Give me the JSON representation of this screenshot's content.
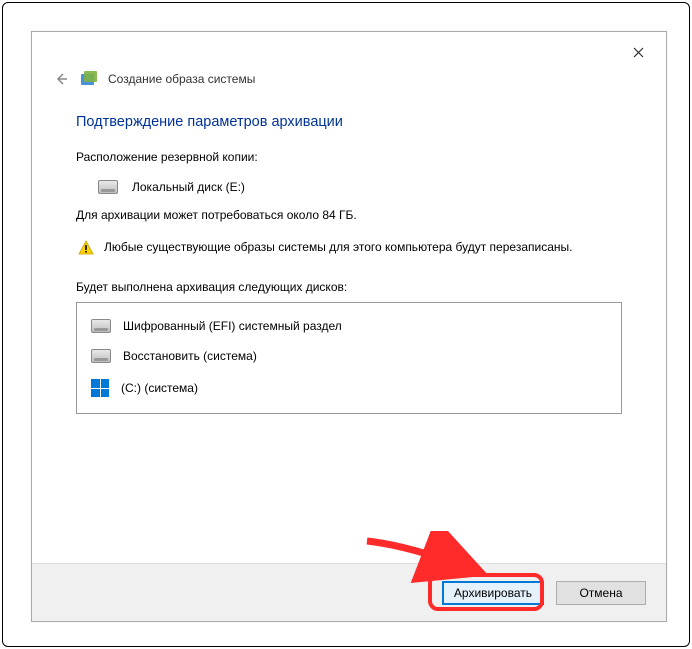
{
  "header": {
    "title": "Создание образа системы"
  },
  "page": {
    "heading": "Подтверждение параметров архивации",
    "location_label": "Расположение резервной копии:",
    "location_drive": "Локальный диск (E:)",
    "size_info": "Для архивации может потребоваться около 84 ГБ.",
    "warning": "Любые существующие образы системы для этого компьютера будут перезаписаны.",
    "drives_label": "Будет выполнена архивация следующих дисков:",
    "drives": [
      {
        "name": "Шифрованный (EFI) системный раздел",
        "icon": "disk"
      },
      {
        "name": "Восстановить (система)",
        "icon": "disk"
      },
      {
        "name": "(C:) (система)",
        "icon": "windows"
      }
    ]
  },
  "footer": {
    "primary": "Архивировать",
    "cancel": "Отмена"
  }
}
